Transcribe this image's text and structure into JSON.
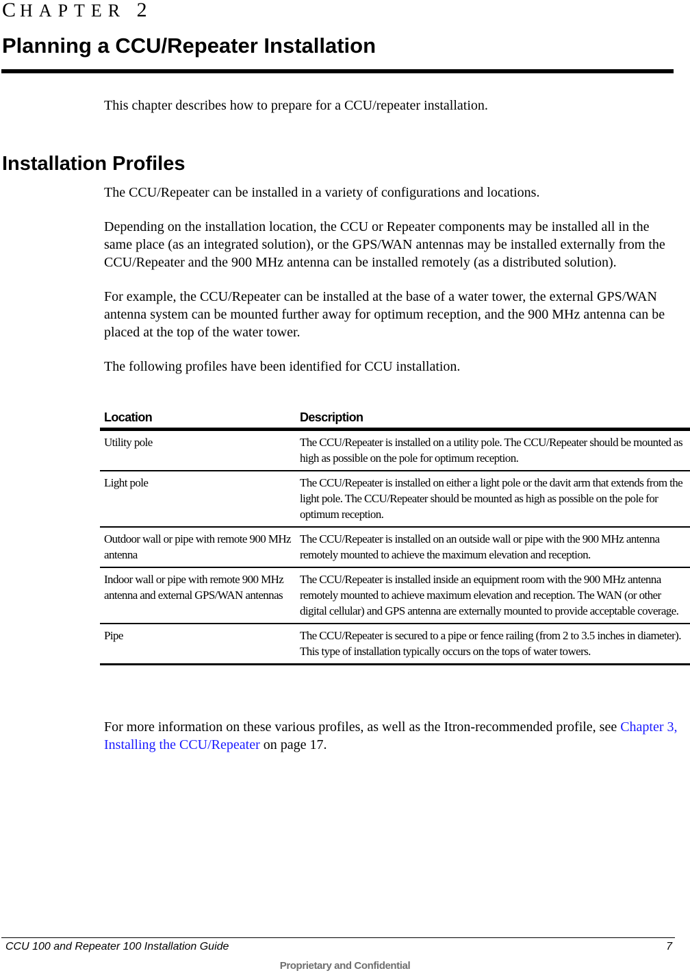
{
  "chapter": {
    "label_first": "C",
    "label_rest": "HAPTER",
    "number": "2",
    "title": "Planning a CCU/Repeater Installation"
  },
  "intro": "This chapter describes how to prepare for a CCU/repeater installation.",
  "section": {
    "title": "Installation Profiles",
    "paragraphs": [
      "The CCU/Repeater can be installed in a variety of configurations and locations.",
      "Depending on the installation location, the CCU or Repeater components may be installed all in the same place (as an integrated solution), or the GPS/WAN antennas may be installed externally from the CCU/Repeater and the 900 MHz antenna can be installed remotely (as a distributed solution).",
      "For example, the CCU/Repeater can be installed at the base of a water tower, the external GPS/WAN antenna system can be mounted further away for optimum reception, and the 900 MHz antenna can be placed at the top of the water tower.",
      "The following profiles have been identified for CCU installation."
    ]
  },
  "table": {
    "headers": [
      "Location",
      "Description"
    ],
    "rows": [
      {
        "location": "Utility pole",
        "description": "The CCU/Repeater is installed on a utility pole. The CCU/Repeater should be mounted as high as possible on the pole for optimum reception."
      },
      {
        "location": "Light pole",
        "description": "The CCU/Repeater is installed on either a light pole or the davit arm that extends from the light pole. The CCU/Repeater should be mounted as high as possible on the pole for optimum reception."
      },
      {
        "location": "Outdoor wall or pipe with remote 900 MHz antenna",
        "description": "The CCU/Repeater is installed on an outside wall or pipe with the 900 MHz antenna remotely mounted to achieve the maximum elevation and reception."
      },
      {
        "location": "Indoor wall or pipe with remote 900 MHz antenna and external GPS/WAN antennas",
        "description": "The CCU/Repeater is installed inside an equipment room with the 900 MHz antenna remotely mounted to achieve maximum elevation and reception.  The WAN (or other digital cellular) and GPS antenna are externally mounted to provide acceptable coverage."
      },
      {
        "location": "Pipe",
        "description": "The CCU/Repeater is secured to a pipe or fence railing  (from 2 to 3.5 inches in diameter). This type of installation typically occurs on the tops of water towers."
      }
    ]
  },
  "closing": {
    "text_before": "For more information on these various profiles, as well as the Itron-recommended profile, see ",
    "link_text": "Chapter 3, Installing the CCU/Repeater",
    "text_after": " on page 17."
  },
  "colors": {
    "link": "#1a1aff",
    "confidential": "#6e6e6e"
  },
  "footer": {
    "title": "CCU 100 and Repeater 100 Installation Guide",
    "page_number": "7",
    "confidential": "Proprietary and Confidential"
  }
}
